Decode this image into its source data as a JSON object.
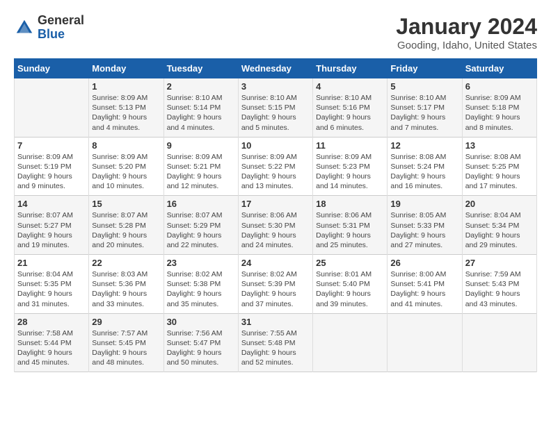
{
  "header": {
    "logo_line1": "General",
    "logo_line2": "Blue",
    "title": "January 2024",
    "subtitle": "Gooding, Idaho, United States"
  },
  "weekdays": [
    "Sunday",
    "Monday",
    "Tuesday",
    "Wednesday",
    "Thursday",
    "Friday",
    "Saturday"
  ],
  "weeks": [
    [
      {
        "day": "",
        "text": ""
      },
      {
        "day": "1",
        "text": "Sunrise: 8:09 AM\nSunset: 5:13 PM\nDaylight: 9 hours\nand 4 minutes."
      },
      {
        "day": "2",
        "text": "Sunrise: 8:10 AM\nSunset: 5:14 PM\nDaylight: 9 hours\nand 4 minutes."
      },
      {
        "day": "3",
        "text": "Sunrise: 8:10 AM\nSunset: 5:15 PM\nDaylight: 9 hours\nand 5 minutes."
      },
      {
        "day": "4",
        "text": "Sunrise: 8:10 AM\nSunset: 5:16 PM\nDaylight: 9 hours\nand 6 minutes."
      },
      {
        "day": "5",
        "text": "Sunrise: 8:10 AM\nSunset: 5:17 PM\nDaylight: 9 hours\nand 7 minutes."
      },
      {
        "day": "6",
        "text": "Sunrise: 8:09 AM\nSunset: 5:18 PM\nDaylight: 9 hours\nand 8 minutes."
      }
    ],
    [
      {
        "day": "7",
        "text": "Sunrise: 8:09 AM\nSunset: 5:19 PM\nDaylight: 9 hours\nand 9 minutes."
      },
      {
        "day": "8",
        "text": "Sunrise: 8:09 AM\nSunset: 5:20 PM\nDaylight: 9 hours\nand 10 minutes."
      },
      {
        "day": "9",
        "text": "Sunrise: 8:09 AM\nSunset: 5:21 PM\nDaylight: 9 hours\nand 12 minutes."
      },
      {
        "day": "10",
        "text": "Sunrise: 8:09 AM\nSunset: 5:22 PM\nDaylight: 9 hours\nand 13 minutes."
      },
      {
        "day": "11",
        "text": "Sunrise: 8:09 AM\nSunset: 5:23 PM\nDaylight: 9 hours\nand 14 minutes."
      },
      {
        "day": "12",
        "text": "Sunrise: 8:08 AM\nSunset: 5:24 PM\nDaylight: 9 hours\nand 16 minutes."
      },
      {
        "day": "13",
        "text": "Sunrise: 8:08 AM\nSunset: 5:25 PM\nDaylight: 9 hours\nand 17 minutes."
      }
    ],
    [
      {
        "day": "14",
        "text": "Sunrise: 8:07 AM\nSunset: 5:27 PM\nDaylight: 9 hours\nand 19 minutes."
      },
      {
        "day": "15",
        "text": "Sunrise: 8:07 AM\nSunset: 5:28 PM\nDaylight: 9 hours\nand 20 minutes."
      },
      {
        "day": "16",
        "text": "Sunrise: 8:07 AM\nSunset: 5:29 PM\nDaylight: 9 hours\nand 22 minutes."
      },
      {
        "day": "17",
        "text": "Sunrise: 8:06 AM\nSunset: 5:30 PM\nDaylight: 9 hours\nand 24 minutes."
      },
      {
        "day": "18",
        "text": "Sunrise: 8:06 AM\nSunset: 5:31 PM\nDaylight: 9 hours\nand 25 minutes."
      },
      {
        "day": "19",
        "text": "Sunrise: 8:05 AM\nSunset: 5:33 PM\nDaylight: 9 hours\nand 27 minutes."
      },
      {
        "day": "20",
        "text": "Sunrise: 8:04 AM\nSunset: 5:34 PM\nDaylight: 9 hours\nand 29 minutes."
      }
    ],
    [
      {
        "day": "21",
        "text": "Sunrise: 8:04 AM\nSunset: 5:35 PM\nDaylight: 9 hours\nand 31 minutes."
      },
      {
        "day": "22",
        "text": "Sunrise: 8:03 AM\nSunset: 5:36 PM\nDaylight: 9 hours\nand 33 minutes."
      },
      {
        "day": "23",
        "text": "Sunrise: 8:02 AM\nSunset: 5:38 PM\nDaylight: 9 hours\nand 35 minutes."
      },
      {
        "day": "24",
        "text": "Sunrise: 8:02 AM\nSunset: 5:39 PM\nDaylight: 9 hours\nand 37 minutes."
      },
      {
        "day": "25",
        "text": "Sunrise: 8:01 AM\nSunset: 5:40 PM\nDaylight: 9 hours\nand 39 minutes."
      },
      {
        "day": "26",
        "text": "Sunrise: 8:00 AM\nSunset: 5:41 PM\nDaylight: 9 hours\nand 41 minutes."
      },
      {
        "day": "27",
        "text": "Sunrise: 7:59 AM\nSunset: 5:43 PM\nDaylight: 9 hours\nand 43 minutes."
      }
    ],
    [
      {
        "day": "28",
        "text": "Sunrise: 7:58 AM\nSunset: 5:44 PM\nDaylight: 9 hours\nand 45 minutes."
      },
      {
        "day": "29",
        "text": "Sunrise: 7:57 AM\nSunset: 5:45 PM\nDaylight: 9 hours\nand 48 minutes."
      },
      {
        "day": "30",
        "text": "Sunrise: 7:56 AM\nSunset: 5:47 PM\nDaylight: 9 hours\nand 50 minutes."
      },
      {
        "day": "31",
        "text": "Sunrise: 7:55 AM\nSunset: 5:48 PM\nDaylight: 9 hours\nand 52 minutes."
      },
      {
        "day": "",
        "text": ""
      },
      {
        "day": "",
        "text": ""
      },
      {
        "day": "",
        "text": ""
      }
    ]
  ]
}
